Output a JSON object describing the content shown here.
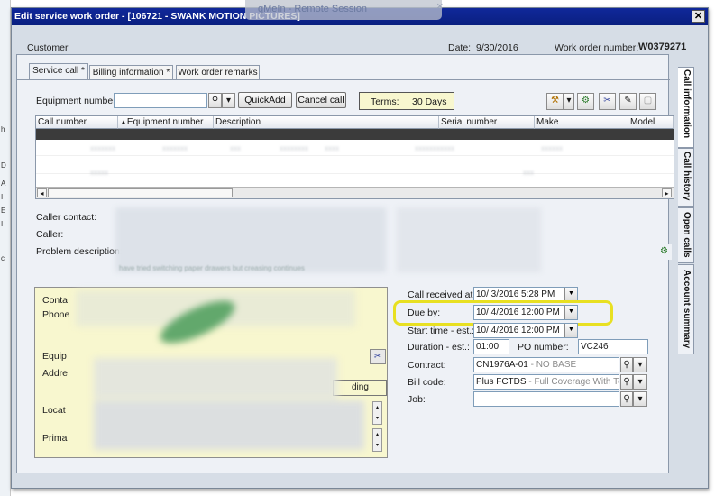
{
  "window": {
    "title": "Edit service work order - [106721 - SWANK MOTION PICTURES]",
    "close_glyph": "✕"
  },
  "remote_session": {
    "label": "qMeIn - Remote Session",
    "close_glyph": "×"
  },
  "header": {
    "customer_label": "Customer",
    "date_label": "Date:",
    "date_value": "9/30/2016",
    "work_order_label": "Work order number:",
    "work_order_value": "W0379271"
  },
  "tabs": [
    {
      "label": "Service call *"
    },
    {
      "label": "Billing information *"
    },
    {
      "label": "Work order remarks"
    }
  ],
  "side_tabs": [
    {
      "label": "Call information"
    },
    {
      "label": "Call history"
    },
    {
      "label": "Open calls"
    },
    {
      "label": "Account summary"
    }
  ],
  "toolbar": {
    "equipment_number_label": "Equipment number:",
    "equipment_number_value": "",
    "quickadd_label": "QuickAdd",
    "cancel_call_label": "Cancel call",
    "terms_label": "Terms:",
    "terms_value": "30 Days",
    "icons": [
      "wrench-icon",
      "gear-icon",
      "tools-icon",
      "pencil-icon",
      "document-icon"
    ]
  },
  "grid": {
    "columns": [
      {
        "label": "Call number"
      },
      {
        "label": "Equipment number"
      },
      {
        "label": "Description"
      },
      {
        "label": "Serial number"
      },
      {
        "label": "Make"
      },
      {
        "label": "Model"
      }
    ],
    "sort_indicator": "▲"
  },
  "caller": {
    "caller_contact_label": "Caller contact:",
    "caller_label": "Caller:",
    "problem_description_label": "Problem description:",
    "problem_description_partial": "have tried switching paper drawers but creasing continues"
  },
  "contact_card": {
    "contact_label": "Conta",
    "phone_label": "Phone",
    "equipment_label": "Equip",
    "address_label": "Addre",
    "location_label": "Locat",
    "primary_label": "Prima",
    "pending_label": "ding"
  },
  "schedule": {
    "call_received_label": "Call received at:",
    "call_received_value": "10/  3/2016  5:28 PM",
    "due_by_label": "Due by:",
    "due_by_value": "10/  4/2016 12:00 PM",
    "start_time_label": "Start time - est.:",
    "start_time_value": "10/  4/2016 12:00 PM",
    "duration_label": "Duration - est.:",
    "duration_value": "01:00",
    "po_number_label": "PO number:",
    "po_number_value": "VC246",
    "contract_label": "Contract:",
    "contract_value": "CN1976A-01",
    "contract_suffix": " - NO BASE",
    "bill_code_label": "Bill code:",
    "bill_code_value": "Plus FCTDS",
    "bill_code_suffix": " - Full Coverage With Toner D",
    "job_label": "Job:",
    "job_value": ""
  },
  "colors": {
    "titlebar": "#10289a",
    "highlight": "#e8e022",
    "card": "#f8f7cf"
  }
}
